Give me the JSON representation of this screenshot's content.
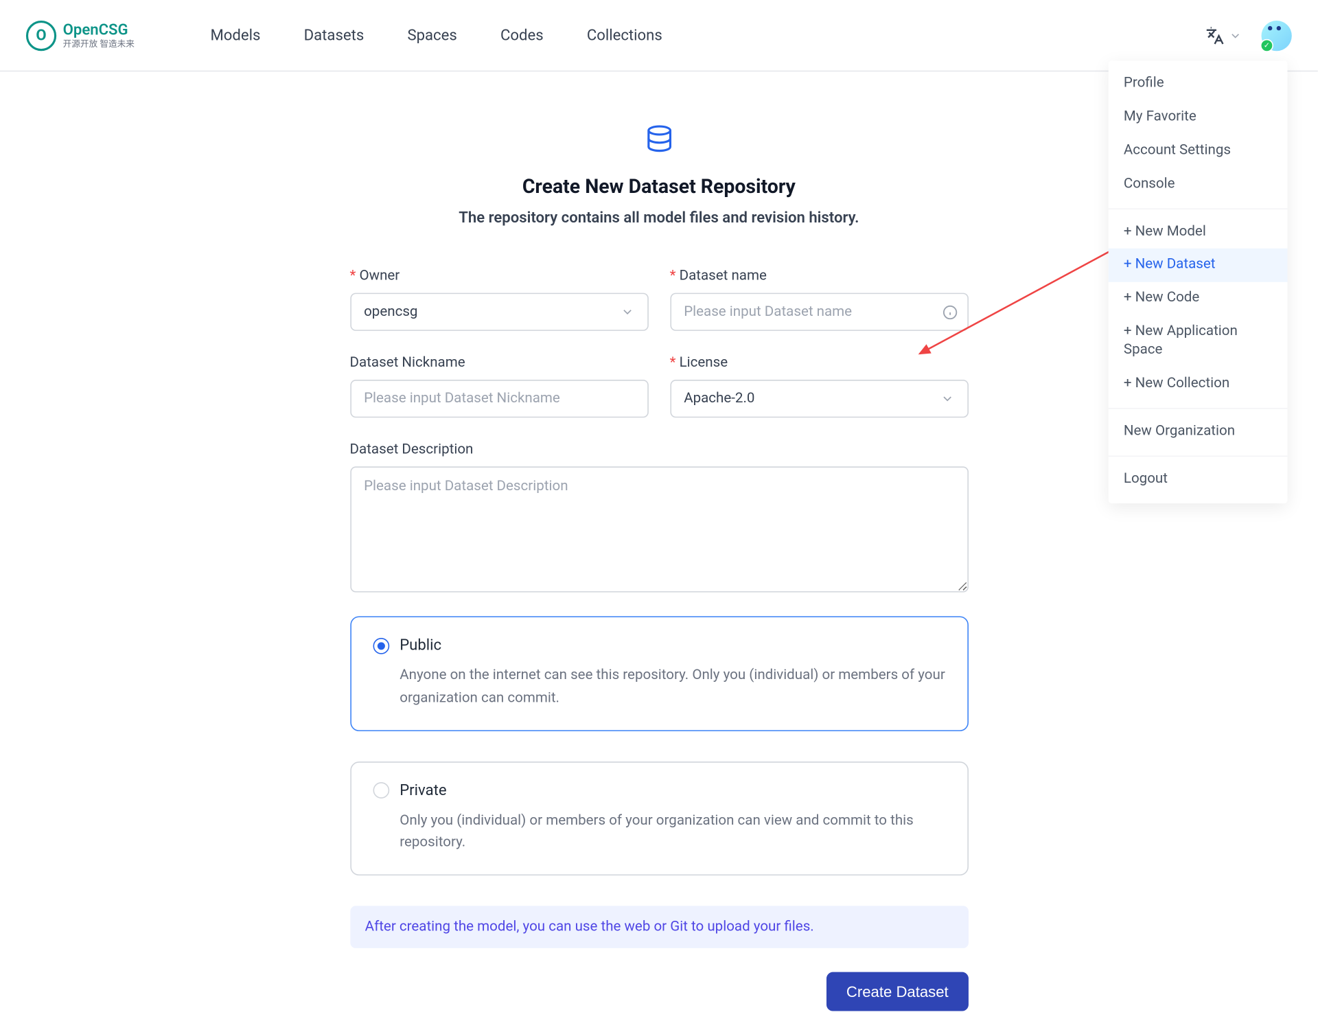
{
  "brand": {
    "name": "OpenCSG",
    "tagline": "开源开放 智造未来"
  },
  "nav": [
    "Models",
    "Datasets",
    "Spaces",
    "Codes",
    "Collections"
  ],
  "dropdown": {
    "account": [
      "Profile",
      "My Favorite",
      "Account Settings",
      "Console"
    ],
    "create": [
      "+ New Model",
      "+ New Dataset",
      "+ New Code",
      "+ New Application Space",
      "+ New Collection"
    ],
    "org": [
      "New Organization"
    ],
    "out": [
      "Logout"
    ]
  },
  "page": {
    "title": "Create New Dataset Repository",
    "subtitle": "The repository contains all model files and revision history."
  },
  "form": {
    "owner_label": "Owner",
    "owner_value": "opencsg",
    "name_label": "Dataset name",
    "name_placeholder": "Please input Dataset name",
    "nickname_label": "Dataset Nickname",
    "nickname_placeholder": "Please input Dataset Nickname",
    "license_label": "License",
    "license_value": "Apache-2.0",
    "desc_label": "Dataset Description",
    "desc_placeholder": "Please input Dataset Description",
    "public_label": "Public",
    "public_desc": "Anyone on the internet can see this repository. Only you (individual) or members of your organization can commit.",
    "private_label": "Private",
    "private_desc": "Only you (individual) or members of your organization can view and commit to this repository.",
    "info_banner": "After creating the model, you can use the web or Git to upload your files.",
    "submit": "Create Dataset"
  }
}
